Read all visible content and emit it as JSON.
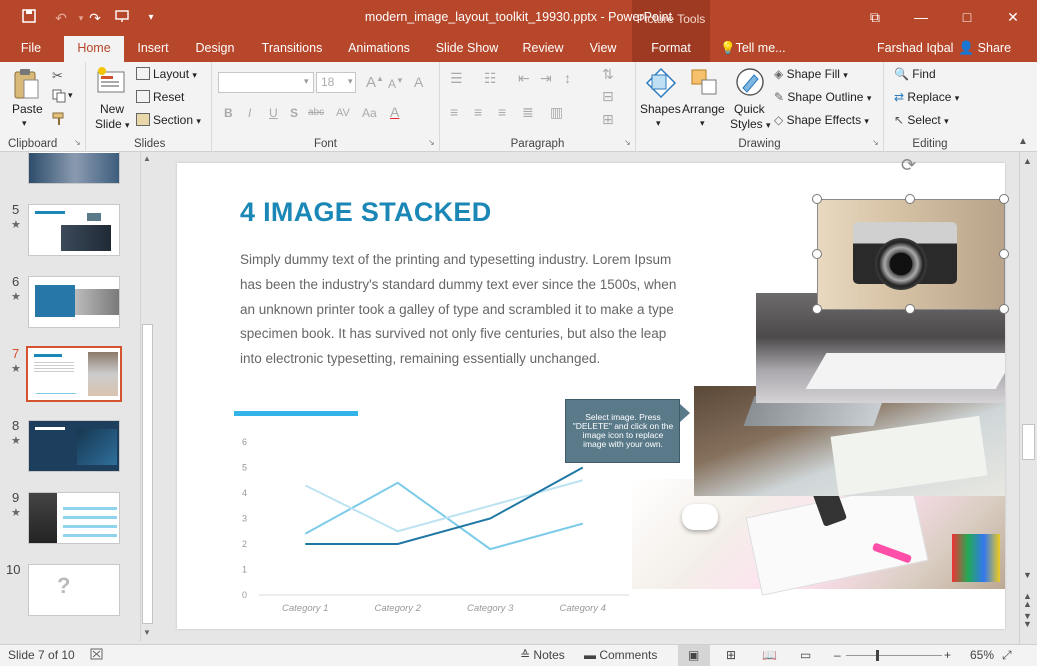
{
  "window": {
    "document_title": "modern_image_layout_toolkit_19930.pptx - PowerPoint",
    "context_tools": "Picture Tools",
    "minimize_glyph": "—",
    "maximize_glyph": "□",
    "close_glyph": "✕",
    "restore_glyph": "⧉"
  },
  "tabs": [
    {
      "label": "File"
    },
    {
      "label": "Home"
    },
    {
      "label": "Insert"
    },
    {
      "label": "Design"
    },
    {
      "label": "Transitions"
    },
    {
      "label": "Animations"
    },
    {
      "label": "Slide Show"
    },
    {
      "label": "Review"
    },
    {
      "label": "View"
    },
    {
      "label": "Format"
    }
  ],
  "tell_me": "Tell me...",
  "user_name": "Farshad Iqbal",
  "share_label": "Share",
  "ribbon": {
    "clipboard": {
      "label": "Clipboard",
      "paste": "Paste"
    },
    "slides": {
      "label": "Slides",
      "new_slide_1": "New",
      "new_slide_2": "Slide",
      "layout": "Layout",
      "reset": "Reset",
      "section": "Section"
    },
    "font": {
      "label": "Font",
      "size": "18",
      "bold": "B",
      "italic": "I",
      "underline": "U",
      "strike": "S",
      "shadow": "abc",
      "spacing": "AV",
      "case": "Aa",
      "grow": "A",
      "shrink": "A",
      "clear": "A"
    },
    "paragraph": {
      "label": "Paragraph"
    },
    "drawing": {
      "label": "Drawing",
      "shapes": "Shapes",
      "arrange": "Arrange",
      "quick_styles_1": "Quick",
      "quick_styles_2": "Styles",
      "shape_fill": "Shape Fill",
      "shape_outline": "Shape Outline",
      "shape_effects": "Shape Effects"
    },
    "editing": {
      "label": "Editing",
      "find": "Find",
      "replace": "Replace",
      "select": "Select"
    }
  },
  "thumbnails": [
    {
      "num": "5"
    },
    {
      "num": "6"
    },
    {
      "num": "7"
    },
    {
      "num": "8"
    },
    {
      "num": "9"
    },
    {
      "num": "10"
    }
  ],
  "slide": {
    "title": "4 IMAGE STACKED",
    "body": "Simply dummy text of the printing and typesetting industry. Lorem Ipsum has been the industry's standard dummy text ever since the 1500s, when an unknown printer took a galley of type and scrambled it to make a type specimen book. It has survived not only five centuries, but also the leap into electronic typesetting, remaining essentially unchanged.",
    "callout": "Select image. Press \"DELETE\" and click on the image icon to replace image with your own."
  },
  "chart_data": {
    "type": "line",
    "categories": [
      "Category 1",
      "Category 2",
      "Category 3",
      "Category 4"
    ],
    "series": [
      {
        "values": [
          2.0,
          2.0,
          3.0,
          5.0
        ],
        "color": "#1f77a4"
      },
      {
        "values": [
          4.3,
          2.5,
          3.5,
          4.5
        ],
        "color": "#bde3f2"
      },
      {
        "values": [
          2.4,
          4.4,
          1.8,
          2.8
        ],
        "color": "#7ccbe8"
      }
    ],
    "ylim": [
      0,
      6
    ],
    "yticks": [
      "0",
      "1",
      "2",
      "3",
      "4",
      "5",
      "6"
    ],
    "grid": false,
    "accent_bar_color": "#33b5e9"
  },
  "status": {
    "slide_info": "Slide 7 of 10",
    "notes": "Notes",
    "comments": "Comments",
    "zoom": "65%",
    "zoom_level": 0.65
  },
  "colors": {
    "brand": "#b7472a",
    "title_blue": "#1a87b6",
    "callout": "#5a7a8a"
  }
}
